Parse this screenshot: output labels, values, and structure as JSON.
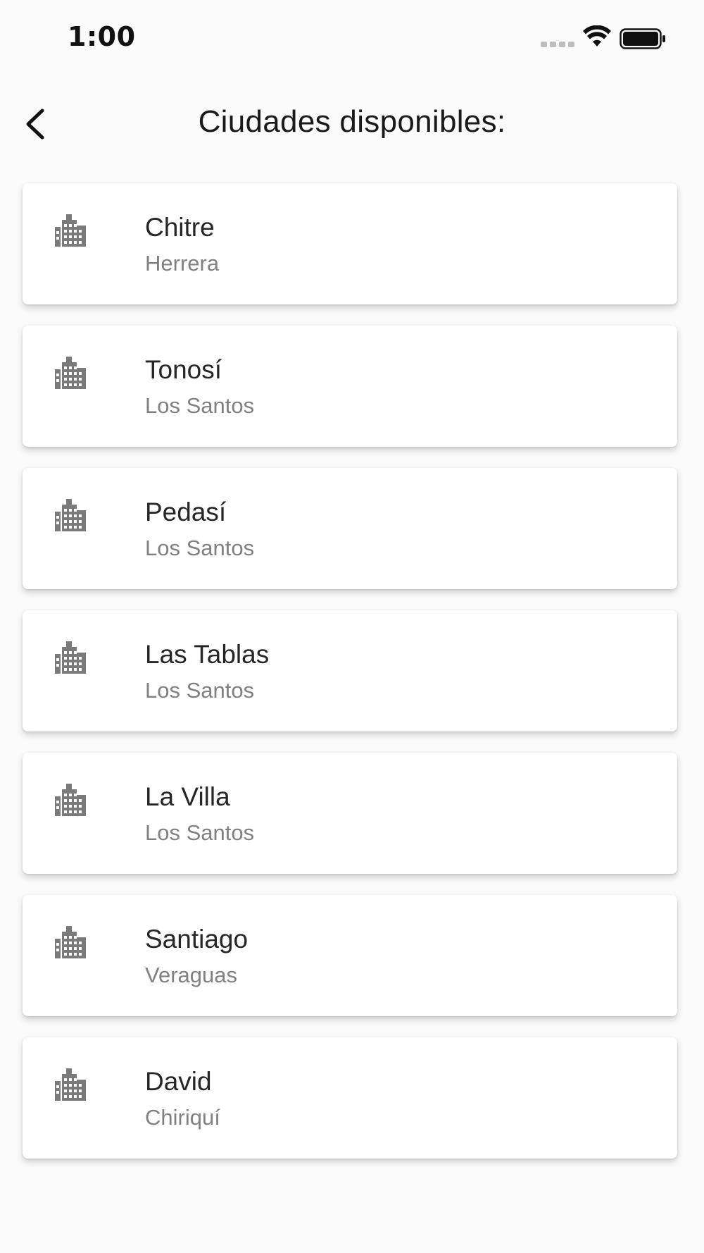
{
  "status_bar": {
    "time": "1:00",
    "icons": [
      "signal-icon",
      "wifi-icon",
      "battery-icon"
    ]
  },
  "header": {
    "title": "Ciudades disponibles:",
    "back_icon": "chevron-left-icon"
  },
  "cities": [
    {
      "name": "Chitre",
      "province": "Herrera",
      "icon": "city-icon"
    },
    {
      "name": "Tonosí",
      "province": "Los Santos",
      "icon": "city-icon"
    },
    {
      "name": "Pedasí",
      "province": "Los Santos",
      "icon": "city-icon"
    },
    {
      "name": "Las Tablas",
      "province": "Los Santos",
      "icon": "city-icon"
    },
    {
      "name": "La Villa",
      "province": "Los Santos",
      "icon": "city-icon"
    },
    {
      "name": "Santiago",
      "province": "Veraguas",
      "icon": "city-icon"
    },
    {
      "name": "David",
      "province": "Chiriquí",
      "icon": "city-icon"
    }
  ],
  "colors": {
    "background": "#fafafa",
    "card": "#ffffff",
    "icon": "#7a7a7a",
    "secondary_text": "#808080"
  }
}
